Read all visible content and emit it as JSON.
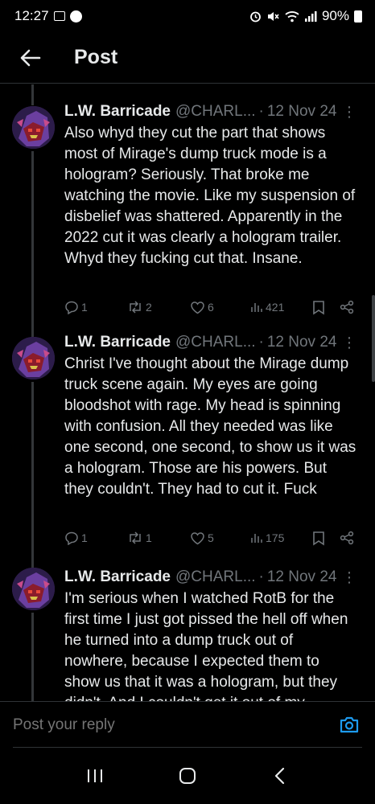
{
  "status_bar": {
    "time": "12:27",
    "battery": "90%",
    "icons": [
      "gallery-icon",
      "messenger-icon",
      "alarm-icon",
      "mute-icon",
      "wifi-icon",
      "signal-icon",
      "battery-icon"
    ]
  },
  "header": {
    "title": "Post",
    "back_icon": "arrow-left-icon"
  },
  "posts": [
    {
      "author": "L.W. Barricade",
      "handle": "@CHARL...",
      "sep": "·",
      "date": "12 Nov 24",
      "more": "⋮",
      "text": "Also whyd they cut the part that shows most of Mirage's dump truck mode is a hologram? Seriously. That broke me watching the movie. Like my suspension of disbelief was shattered. Apparently in the 2022 cut it was clearly a hologram trailer. Whyd they fucking cut that. Insane.",
      "replies": "1",
      "reposts": "2",
      "likes": "6",
      "views": "421"
    },
    {
      "author": "L.W. Barricade",
      "handle": "@CHARL...",
      "sep": "·",
      "date": "12 Nov 24",
      "more": "⋮",
      "text": "Christ I've thought about the Mirage dump truck scene again. My eyes are going bloodshot with rage. My head is spinning with confusion. All they needed was like one second, one second, to show us it was a hologram. Those are his powers. But they couldn't. They had to cut it. Fuck",
      "replies": "1",
      "reposts": "1",
      "likes": "5",
      "views": "175"
    },
    {
      "author": "L.W. Barricade",
      "handle": "@CHARL...",
      "sep": "·",
      "date": "12 Nov 24",
      "more": "⋮",
      "text": "I'm serious when I watched RotB for the first time I just got pissed the hell off when he turned into a dump truck out of nowhere, because I expected them to show us that it was a hologram, but they didn't. And I couldn't get it out of my"
    }
  ],
  "reply": {
    "placeholder": "Post your reply",
    "camera_icon": "camera-icon"
  },
  "nav": {
    "recents_icon": "recents-icon",
    "home_icon": "home-icon",
    "back_icon": "back-chevron-icon"
  },
  "colors": {
    "background": "#000000",
    "text": "#e7e9ea",
    "muted": "#71767b",
    "accent": "#1d9bf0",
    "divider": "#2f3336"
  }
}
